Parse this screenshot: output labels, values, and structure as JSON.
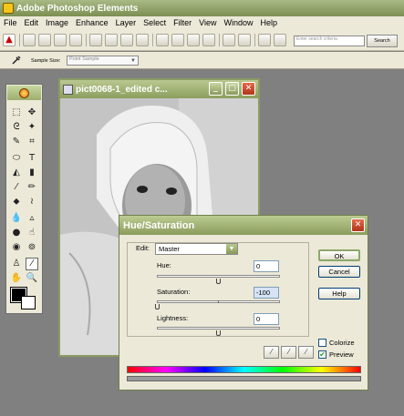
{
  "app": {
    "title": "Adobe Photoshop Elements"
  },
  "menu": [
    "File",
    "Edit",
    "Image",
    "Enhance",
    "Layer",
    "Select",
    "Filter",
    "View",
    "Window",
    "Help"
  ],
  "toolbar": {
    "search_placeholder": "Enter search criteria",
    "search_label": "Search"
  },
  "options_bar": {
    "sample_size_label": "Sample Size:",
    "sample_size_value": "Point Sample"
  },
  "document": {
    "title": "pict0068-1_edited c..."
  },
  "dialog": {
    "title": "Hue/Saturation",
    "edit_label": "Edit:",
    "edit_value": "Master",
    "hue_label": "Hue:",
    "hue_value": "0",
    "saturation_label": "Saturation:",
    "saturation_value": "-100",
    "lightness_label": "Lightness:",
    "lightness_value": "0",
    "ok_label": "OK",
    "cancel_label": "Cancel",
    "help_label": "Help",
    "colorize_label": "Colorize",
    "colorize_checked": false,
    "preview_label": "Preview",
    "preview_checked": true
  }
}
